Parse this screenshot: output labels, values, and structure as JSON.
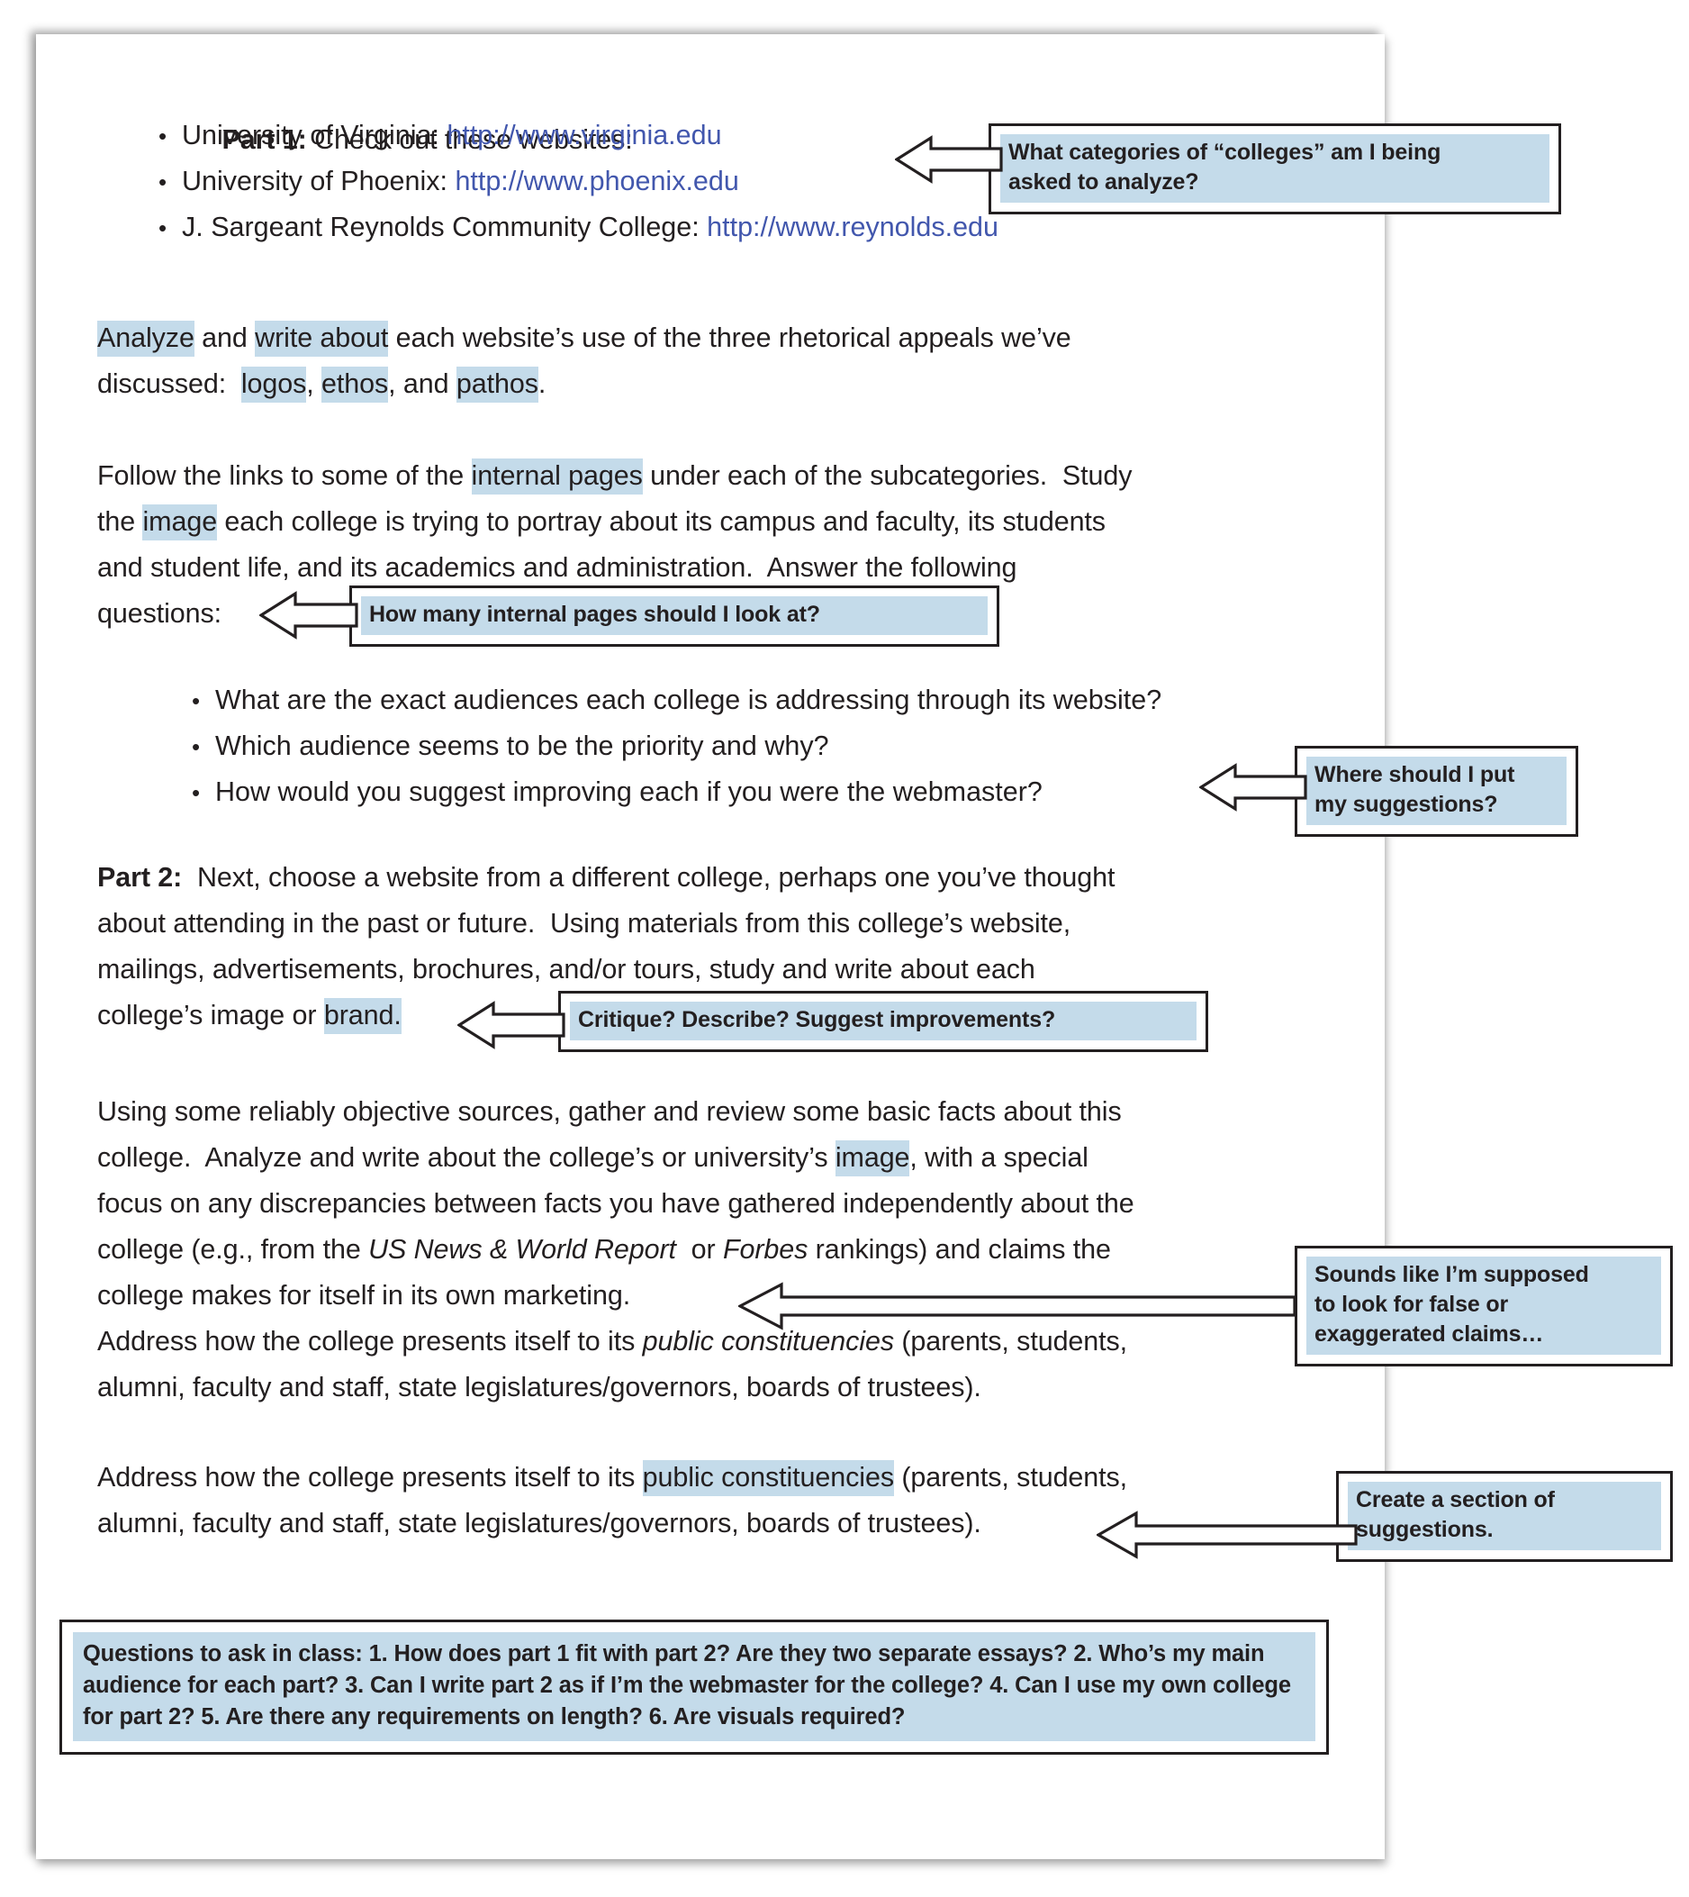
{
  "document": {
    "part1": {
      "label": "Part 1:",
      "intro": " Check out these websites:",
      "links": [
        {
          "name": "University of Virginia: ",
          "url": "http://www.virginia.edu"
        },
        {
          "name": "University of Phoenix: ",
          "url": "http://www.phoenix.edu"
        },
        {
          "name": "J. Sargeant Reynolds Community College: ",
          "url": "http://www.reynolds.edu"
        }
      ]
    },
    "paragraph_analyze": {
      "h1": "Analyze",
      "t1": " and ",
      "h2": "write about",
      "t2": " each website’s use of the three rhetorical appeals we’ve\ndiscussed:  ",
      "h3": "logos",
      "t3": ", ",
      "h4": "ethos",
      "t4": ", and ",
      "h5": "pathos",
      "t5": "."
    },
    "paragraph_follow": {
      "t1": "Follow the links to some of the ",
      "h1": "internal pages",
      "t2": " under each of the subcategories.  Study\nthe ",
      "h2": "image",
      "t3": " each college is trying to portray about its campus and faculty, its students\nand student life, and its academics and administration.  Answer the following\nquestions:"
    },
    "questions": [
      "What are the exact audiences each college is addressing through its website?",
      "Which audience seems to be the priority and why?",
      "How would you suggest improving each if you were the webmaster?"
    ],
    "part2": {
      "label": "Part 2:",
      "t1": "  Next, choose a website from a different college, perhaps one you’ve thought\nabout attending in the past or future.  Using materials from this college’s website,\nmailings, advertisements, brochures, and/or tours, study and write about each\ncollege’s image or ",
      "h1": "brand.",
      "t2": ""
    },
    "paragraph_sources": {
      "t1": "Using some reliably objective sources, gather and review some basic facts about this\ncollege.  Analyze and write about the college’s or university’s ",
      "h1": "image",
      "t2": ", with a special\nfocus on any discrepancies between facts you have gathered independently about the\ncollege (e.g., from the ",
      "i1": "US News & World Report",
      "t3": "  or ",
      "i2": "Forbes",
      "t4": " rankings) and claims the\ncollege makes for itself in its own marketing.\nAddress how the college presents itself to its ",
      "i3": "public constituencies",
      "t5": " (parents, students,\nalumni, faculty and staff, state legislatures/governors, boards of trustees)."
    },
    "paragraph_address": {
      "t1": "Address how the college presents itself to its ",
      "h1": "public constituencies",
      "t2": " (parents, students,\nalumni, faculty and staff, state legislatures/governors, boards of trustees)."
    },
    "bottom_box": {
      "text": "Questions to ask in class:  1. How does part 1 fit with part 2? Are they two separate essays? 2. Who’s my main audience for each part? 3. Can I write part 2 as if I’m the webmaster for the college? 4. Can I use my own college for part 2? 5. Are there any requirements on length? 6. Are visuals required?"
    }
  },
  "annotations": [
    {
      "id": "categories",
      "line1": "What categories of “colleges” am I being",
      "line2": "asked to analyze?"
    },
    {
      "id": "internal",
      "line1": "How many internal pages should I look at?",
      "line2": ""
    },
    {
      "id": "suggestions",
      "line1": "Where should I put",
      "line2": "my suggestions?"
    },
    {
      "id": "critique",
      "line1": "Critique? Describe? Suggest improvements?",
      "line2": ""
    },
    {
      "id": "false-claims",
      "line1": "Sounds like I’m supposed",
      "line2": "to look for false or",
      "line3": "exaggerated claims…"
    },
    {
      "id": "section",
      "line1": "Create a section of",
      "line2": "suggestions."
    }
  ],
  "colors": {
    "highlight": "#c4dbea",
    "link": "#4257ad",
    "ink": "#231f20",
    "paper": "#ffffff"
  },
  "bullet_glyph": "•"
}
